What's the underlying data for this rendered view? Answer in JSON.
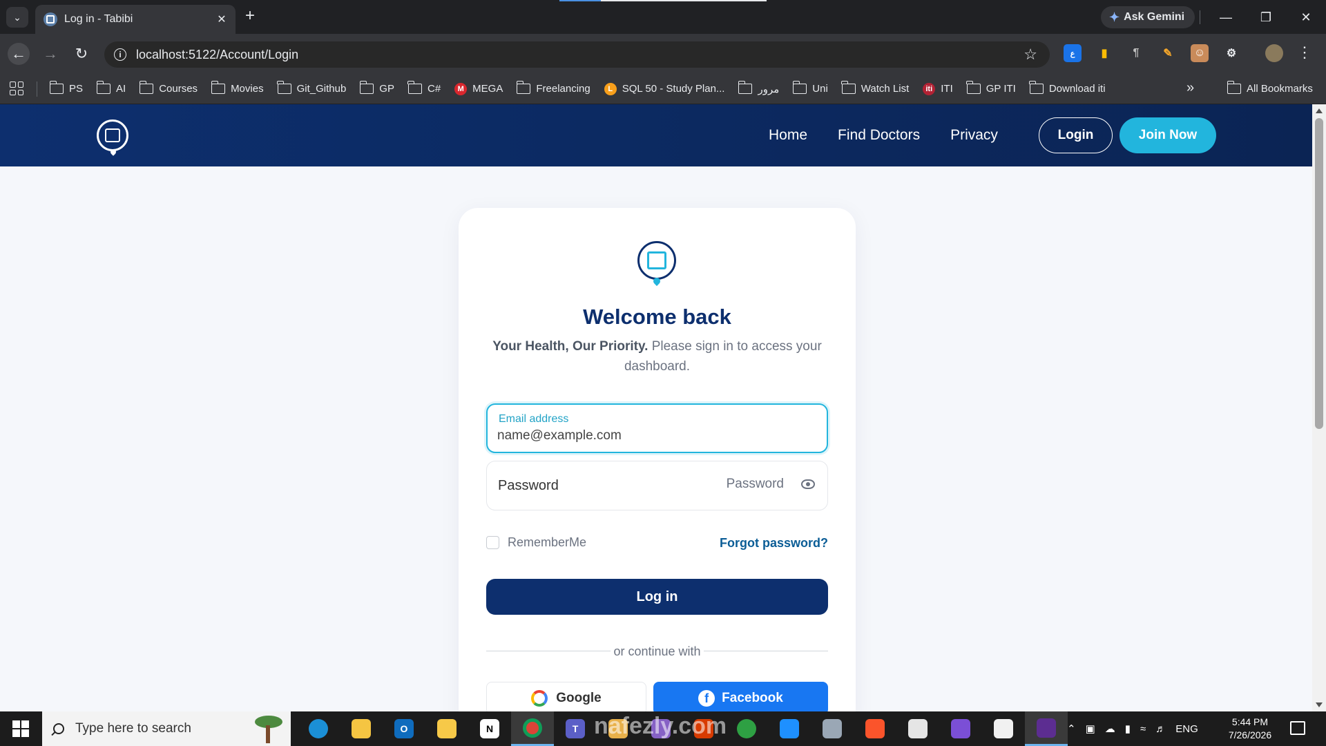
{
  "browser": {
    "tab_title": "Log in - Tabibi",
    "url": "localhost:5122/Account/Login",
    "ask_gemini": "Ask Gemini",
    "bookmarks": [
      {
        "label": "PS",
        "kind": "folder"
      },
      {
        "label": "AI",
        "kind": "folder"
      },
      {
        "label": "Courses",
        "kind": "folder"
      },
      {
        "label": "Movies",
        "kind": "folder"
      },
      {
        "label": "Git_Github",
        "kind": "folder"
      },
      {
        "label": "GP",
        "kind": "folder"
      },
      {
        "label": "C#",
        "kind": "folder"
      },
      {
        "label": "MEGA",
        "kind": "site",
        "color": "#d9272e",
        "glyph": "M"
      },
      {
        "label": "Freelancing",
        "kind": "folder"
      },
      {
        "label": "SQL 50 - Study Plan...",
        "kind": "site",
        "color": "#f89f1b",
        "glyph": "L"
      },
      {
        "label": "مرور",
        "kind": "folder"
      },
      {
        "label": "Uni",
        "kind": "folder"
      },
      {
        "label": "Watch List",
        "kind": "folder"
      },
      {
        "label": "ITI",
        "kind": "site",
        "color": "#b22234",
        "glyph": "iti"
      },
      {
        "label": "GP ITI",
        "kind": "folder"
      },
      {
        "label": "Download iti",
        "kind": "folder"
      }
    ],
    "all_bookmarks": "All Bookmarks"
  },
  "site": {
    "nav": {
      "home": "Home",
      "find_doctors": "Find Doctors",
      "privacy": "Privacy",
      "login": "Login",
      "join_now": "Join Now"
    }
  },
  "login": {
    "title": "Welcome back",
    "subtitle_bold": "Your Health, Our Priority.",
    "subtitle_rest": " Please sign in to access your dashboard.",
    "email_label": "Email address",
    "email_placeholder": "name@example.com",
    "password_label": "Password",
    "password_placeholder": "Password",
    "remember_me": "RememberMe",
    "forgot_password": "Forgot password?",
    "submit": "Log in",
    "divider": "or continue with",
    "google": "Google",
    "facebook": "Facebook"
  },
  "watermark": "nafezly.com",
  "taskbar": {
    "search_placeholder": "Type here to search",
    "language": "ENG",
    "time": "5:44 PM",
    "date": "7/26/2026"
  },
  "colors": {
    "nav_bg": "#0d2f6e",
    "accent": "#22b5dd",
    "primary": "#0d2f6e",
    "facebook": "#1877f2",
    "link": "#0b5d96"
  }
}
